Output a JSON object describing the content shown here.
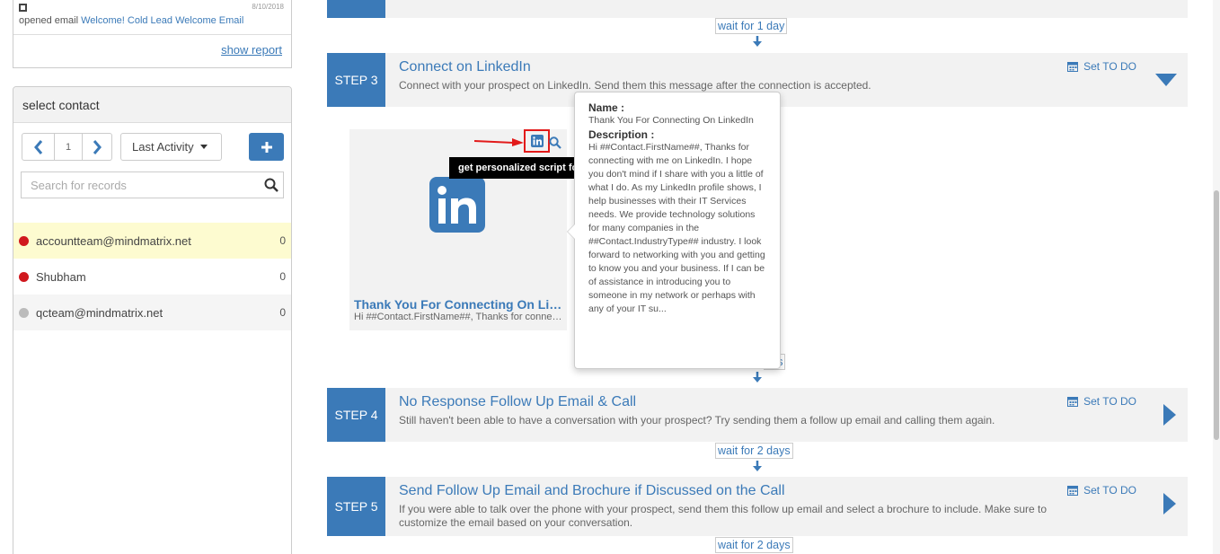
{
  "activity": {
    "date": "8/10/2018",
    "opened_text": "opened email",
    "email_link": "Welcome! Cold Lead Welcome Email",
    "show_report": "show report"
  },
  "contacts": {
    "title": "select contact",
    "page": "1",
    "sort_label": "Last Activity",
    "search_placeholder": "Search for records",
    "items": [
      {
        "name": "accountteam@mindmatrix.net",
        "count": "0",
        "status_color": "#d0181e"
      },
      {
        "name": "Shubham",
        "count": "0",
        "status_color": "#d0181e"
      },
      {
        "name": "qcteam@mindmatrix.net",
        "count": "0",
        "status_color": "#bbbbbb"
      }
    ]
  },
  "steps": [
    {
      "label": "STEP 3",
      "title": "Connect on LinkedIn",
      "description": "Connect with your prospect on LinkedIn. Send them this message after the connection is accepted.",
      "todo": "Set TO DO",
      "expanded": true
    },
    {
      "label": "STEP 4",
      "title": "No Response Follow Up Email & Call",
      "description": "Still haven't been able to have a conversation with your prospect? Try sending them a follow up email and calling them again.",
      "todo": "Set TO DO",
      "expanded": false
    },
    {
      "label": "STEP 5",
      "title": "Send Follow Up Email and Brochure if Discussed on the Call",
      "description": "If you were able to talk over the phone with your prospect, send them this follow up email and select a brochure to include. Make sure to customize the email based on your conversation.",
      "todo": "Set TO DO",
      "expanded": false
    }
  ],
  "waits": [
    "wait for 1 day",
    "ays",
    "wait for 2 days",
    "wait for 2 days"
  ],
  "linkedin_card": {
    "logo_text": "in",
    "title": "Thank You For Connecting On LinkedIn",
    "subtitle": "Hi ##Contact.FirstName##, Thanks for connecting with me on LinkedIn."
  },
  "tooltip": "get personalized script for contact",
  "popover": {
    "name_label": "Name :",
    "name_value": "Thank You For Connecting On LinkedIn",
    "desc_label": "Description :",
    "desc_value": "Hi ##Contact.FirstName##, Thanks for connecting with me on LinkedIn. I hope you don't mind if I share with you a little of what I do. As my LinkedIn profile shows, I help businesses with their IT Services needs. We provide technology solutions for many companies in the ##Contact.IndustryType## industry. I look forward to networking with you and getting to know you and your business. If I can be of assistance in introducing you to someone in my network or perhaps with any of your IT su..."
  },
  "colors": {
    "accent": "#3b7ab8",
    "highlight": "#e21a1a",
    "step_bg": "#f2f2f2"
  }
}
